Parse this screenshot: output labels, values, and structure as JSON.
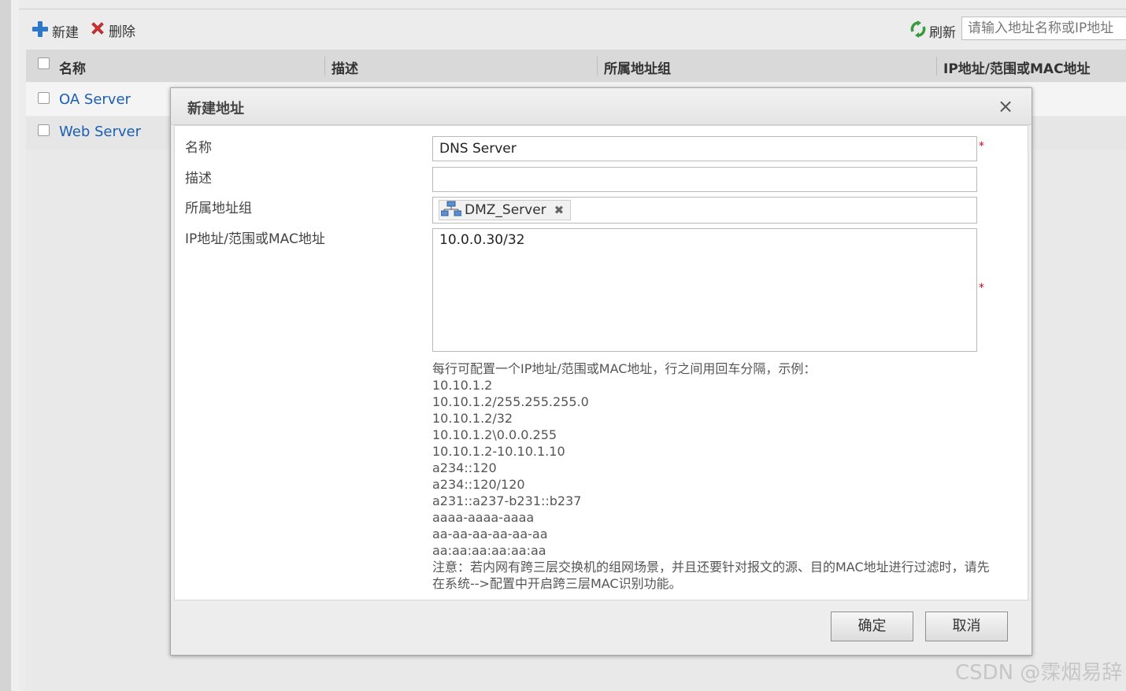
{
  "toolbar": {
    "new_label": "新建",
    "delete_label": "删除",
    "refresh_label": "刷新",
    "search_placeholder": "请输入地址名称或IP地址"
  },
  "grid": {
    "columns": [
      "名称",
      "描述",
      "所属地址组",
      "IP地址/范围或MAC地址"
    ],
    "rows": [
      {
        "name": "OA Server"
      },
      {
        "name": "Web Server"
      }
    ]
  },
  "dialog": {
    "title": "新建地址",
    "close_symbol": "×",
    "labels": {
      "name": "名称",
      "description": "描述",
      "group": "所属地址组",
      "ip": "IP地址/范围或MAC地址"
    },
    "values": {
      "name": "DNS Server",
      "description": "",
      "group_tag": "DMZ_Server",
      "ip": "10.0.0.30/32"
    },
    "required_mark": "*",
    "help": {
      "intro": "每行可配置一个IP地址/范围或MAC地址，行之间用回车分隔，示例：",
      "examples": [
        "10.10.1.2",
        "10.10.1.2/255.255.255.0",
        "10.10.1.2/32",
        "10.10.1.2\\0.0.0.255",
        "10.10.1.2-10.10.1.10",
        "a234::120",
        "a234::120/120",
        "a231::a237-b231::b237",
        "aaaa-aaaa-aaaa",
        "aa-aa-aa-aa-aa-aa",
        "aa:aa:aa:aa:aa:aa"
      ],
      "note": "注意：若内网有跨三层交换机的组网场景，并且还要针对报文的源、目的MAC地址进行过滤时，请先在系统-->配置中开启跨三层MAC识别功能。"
    },
    "ok_label": "确定",
    "cancel_label": "取消"
  },
  "watermark": "CSDN @霂烟易辞",
  "colors": {
    "link": "#1a5fb4",
    "required": "#d9001b",
    "add_icon": "#2e78c9",
    "delete_icon": "#d93535",
    "refresh_icon": "#3a9a3a"
  },
  "icons": {
    "new": "plus-icon",
    "delete": "red-x-icon",
    "refresh": "refresh-icon",
    "group_tag": "network-icon",
    "tag_remove": "close-icon"
  }
}
